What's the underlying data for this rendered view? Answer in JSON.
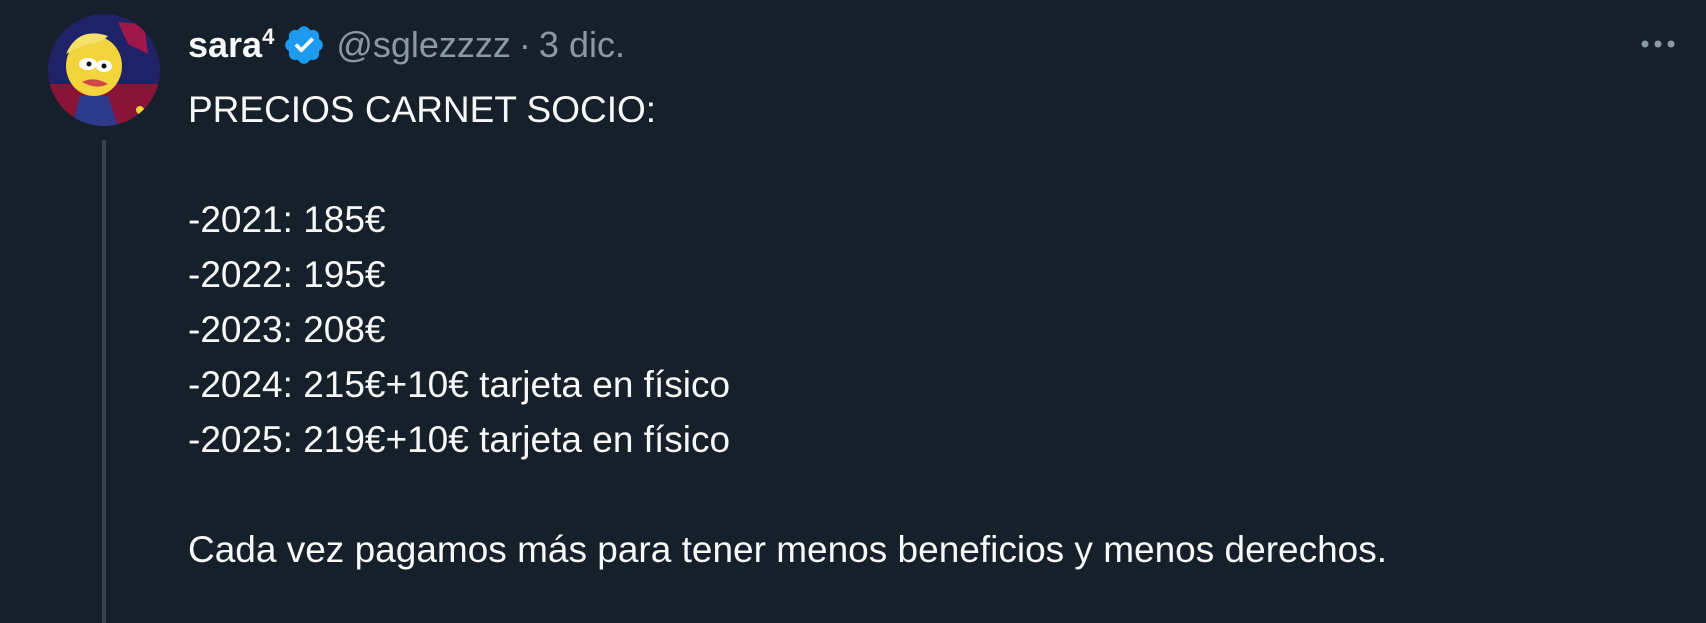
{
  "tweet": {
    "author": {
      "name": "sara",
      "name_superscript": "4",
      "handle": "@sglezzzz",
      "verified": true
    },
    "separator": "·",
    "date": "3 dic.",
    "more_icon": "more-horizontal-icon",
    "text": {
      "title": "PRECIOS CARNET SOCIO:",
      "lines": [
        "-2021: 185€",
        "-2022: 195€",
        "-2023: 208€",
        "-2024: 215€+10€ tarjeta en físico",
        "-2025: 219€+10€ tarjeta en físico"
      ],
      "closing": "Cada vez pagamos más para tener menos beneficios y menos derechos."
    }
  },
  "colors": {
    "background": "#15202b",
    "text_primary": "#f7f9f9",
    "text_secondary": "#8b98a5",
    "verified_badge": "#1d9bf0",
    "thread_line": "#38444d"
  }
}
